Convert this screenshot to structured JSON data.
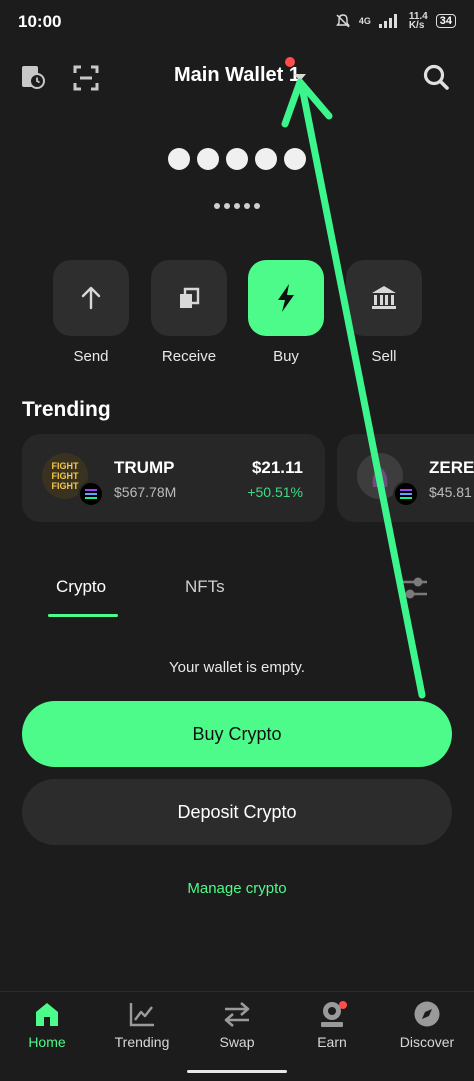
{
  "status_bar": {
    "time": "10:00",
    "network": "4G",
    "speed_top": "11.4",
    "speed_unit": "K/s",
    "battery": "34"
  },
  "header": {
    "wallet_name": "Main Wallet 1"
  },
  "balance": {
    "hidden_big": "●●●●●",
    "hidden_small": "●●●●●"
  },
  "actions": [
    {
      "label": "Send"
    },
    {
      "label": "Receive"
    },
    {
      "label": "Buy"
    },
    {
      "label": "Sell"
    }
  ],
  "trending": {
    "title": "Trending",
    "items": [
      {
        "symbol": "TRUMP",
        "market_cap": "$567.78M",
        "price": "$21.11",
        "change": "+50.51%",
        "logo_text": "FIGHT FIGHT FIGHT"
      },
      {
        "symbol": "ZEREI",
        "market_cap": "$45.81"
      }
    ]
  },
  "tabs": [
    {
      "label": "Crypto"
    },
    {
      "label": "NFTs"
    }
  ],
  "wallet": {
    "empty_text": "Your wallet is empty.",
    "buy_label": "Buy Crypto",
    "deposit_label": "Deposit Crypto",
    "manage_label": "Manage crypto"
  },
  "nav": [
    {
      "label": "Home"
    },
    {
      "label": "Trending"
    },
    {
      "label": "Swap"
    },
    {
      "label": "Earn"
    },
    {
      "label": "Discover"
    }
  ],
  "colors": {
    "accent": "#4dfb8a",
    "background": "#1c1c1c",
    "card": "#272727",
    "positive": "#3ddc84",
    "badge": "#ff4d4d",
    "annotation": "#3cf58c"
  }
}
